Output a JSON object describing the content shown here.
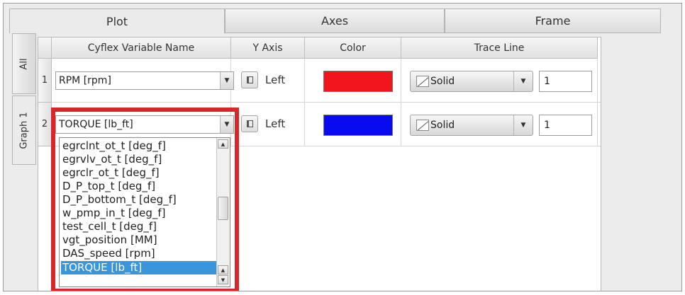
{
  "tabs": [
    {
      "label": "Plot",
      "active": true
    },
    {
      "label": "Axes",
      "active": false
    },
    {
      "label": "Frame",
      "active": false
    }
  ],
  "side_tabs": [
    {
      "label": "All",
      "active": false
    },
    {
      "label": "Graph 1",
      "active": true
    }
  ],
  "table": {
    "headers": {
      "variable": "Cyflex Variable Name",
      "y_axis": "Y Axis",
      "color": "Color",
      "trace_line": "Trace Line"
    },
    "rows": [
      {
        "num": "1",
        "variable": "RPM [rpm]",
        "y_axis": "Left",
        "color": "#f2141c",
        "line_style": "Solid",
        "line_width": "1"
      },
      {
        "num": "2",
        "variable": "TORQUE [lb_ft]",
        "y_axis": "Left",
        "color": "#0a0af0",
        "line_style": "Solid",
        "line_width": "1"
      }
    ]
  },
  "dropdown": {
    "items": [
      "egrclnt_ot_t [deg_f]",
      "egrvlv_ot_t [deg_f]",
      "egrclr_ot_t [deg_f]",
      "D_P_top_t [deg_f]",
      "D_P_bottom_t [deg_f]",
      "w_pmp_in_t [deg_f]",
      "test_cell_t [deg_f]",
      "vgt_position [MM]",
      "DAS_speed [rpm]",
      "TORQUE [lb_ft]"
    ],
    "selected": "TORQUE [lb_ft]"
  },
  "colors": {
    "highlight_border": "#d9262b",
    "selection": "#3a95dc"
  },
  "icons": {
    "combo_arrow": "chevron-down-icon",
    "axis_toggle": "axis-toggle-icon",
    "line_style": "line-style-icon",
    "scroll_up": "arrow-up-icon",
    "scroll_down": "arrow-down-icon"
  }
}
